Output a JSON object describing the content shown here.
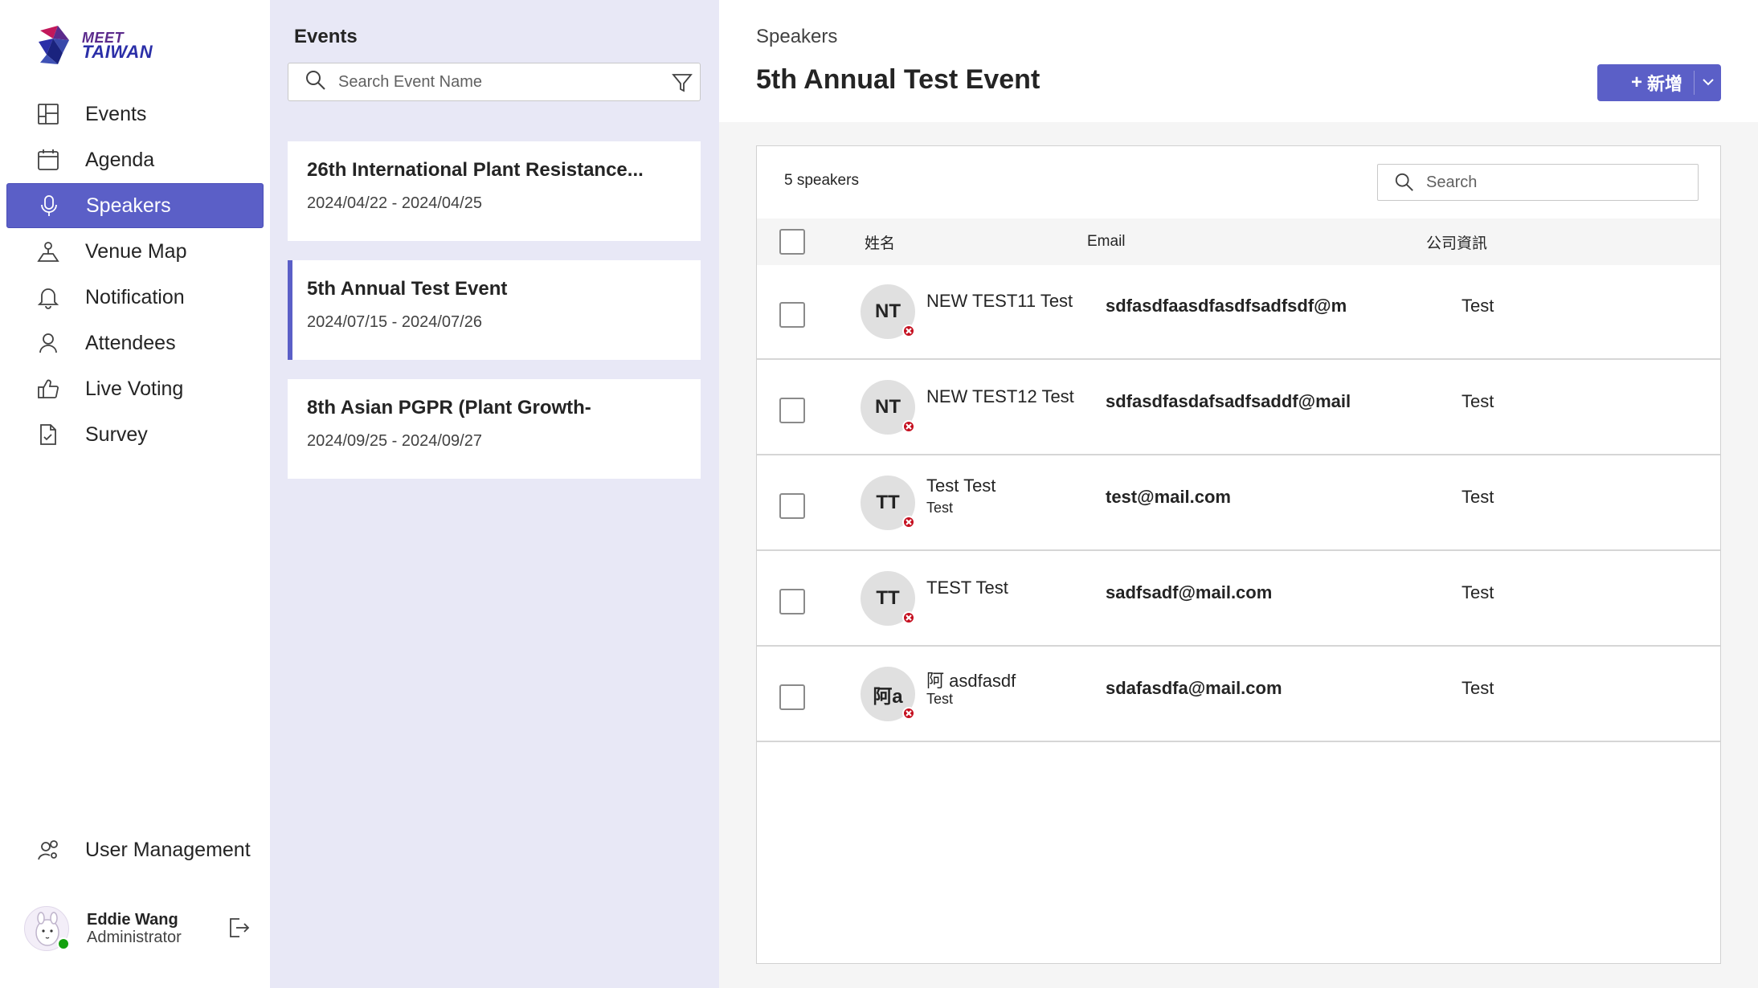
{
  "brand": {
    "line1": "MEET",
    "line2": "TAIWAN"
  },
  "nav": {
    "items": [
      {
        "label": "Events",
        "icon": "layout-icon"
      },
      {
        "label": "Agenda",
        "icon": "calendar-icon"
      },
      {
        "label": "Speakers",
        "icon": "microphone-icon",
        "active": true
      },
      {
        "label": "Venue Map",
        "icon": "map-pin-icon"
      },
      {
        "label": "Notification",
        "icon": "bell-icon"
      },
      {
        "label": "Attendees",
        "icon": "person-icon"
      },
      {
        "label": "Live Voting",
        "icon": "thumbs-up-icon"
      },
      {
        "label": "Survey",
        "icon": "survey-document-icon"
      }
    ],
    "user_management": "User Management"
  },
  "profile": {
    "name": "Eddie Wang",
    "role": "Administrator",
    "presence": "available"
  },
  "events": {
    "title": "Events",
    "search_placeholder": "Search Event Name",
    "list": [
      {
        "name": "26th International Plant Resistance...",
        "dates": "2024/04/22 - 2024/04/25"
      },
      {
        "name": "5th Annual Test Event",
        "dates": "2024/07/15 - 2024/07/26",
        "selected": true
      },
      {
        "name": "8th Asian PGPR (Plant Growth-",
        "dates": "2024/09/25 - 2024/09/27"
      }
    ]
  },
  "main": {
    "breadcrumb": "Speakers",
    "title": "5th Annual Test Event",
    "add_button": {
      "plus": "+",
      "label": "新增"
    },
    "count_text": "5 speakers",
    "search_placeholder": "Search",
    "columns": {
      "name": "姓名",
      "email": "Email",
      "company": "公司資訊"
    },
    "speakers": [
      {
        "initials": "NT",
        "name": "NEW TEST11 Test",
        "subtitle": "",
        "email": "sdfasdfaasdfasdfsadfsdf@m",
        "company": "Test"
      },
      {
        "initials": "NT",
        "name": "NEW TEST12 Test",
        "subtitle": "",
        "email": "sdfasdfasdafsadfsaddf@mail",
        "company": "Test"
      },
      {
        "initials": "TT",
        "name": "Test Test",
        "subtitle": "Test",
        "email": "test@mail.com",
        "company": "Test"
      },
      {
        "initials": "TT",
        "name": "TEST Test",
        "subtitle": "",
        "email": "sadfsadf@mail.com",
        "company": "Test"
      },
      {
        "initials": "阿a",
        "name": "阿 asdfasdf",
        "subtitle": "Test",
        "email": "sdafasdfa@mail.com",
        "company": "Test"
      }
    ]
  },
  "colors": {
    "accent": "#5b5fc7",
    "events_bg": "#e8e8f6",
    "status_busy": "#c50f1f",
    "status_available": "#13a10e"
  }
}
